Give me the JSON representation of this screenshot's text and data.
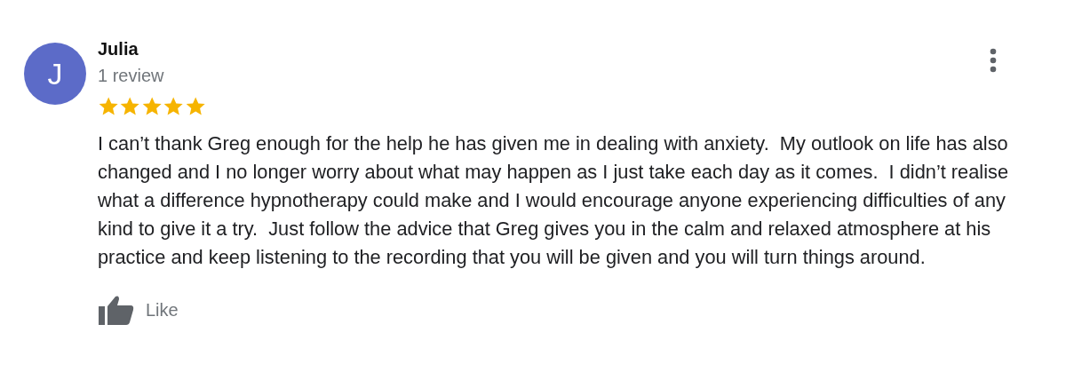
{
  "review": {
    "avatar_letter": "J",
    "author": "Julia",
    "review_count": "1 review",
    "stars": 5,
    "text": "I can’t thank Greg enough for the help he has given me in dealing with anxiety.  My outlook on life has also changed and I no longer worry about what may happen as I just take each day as it comes.  I didn’t realise what a difference hypnotherapy could make and I would encourage anyone experiencing difficulties of any kind to give it a try.  Just follow the advice that Greg gives you in the calm and relaxed atmosphere at his practice and keep listening to the recording that you will be given and you will turn things around.",
    "like_label": "Like"
  }
}
